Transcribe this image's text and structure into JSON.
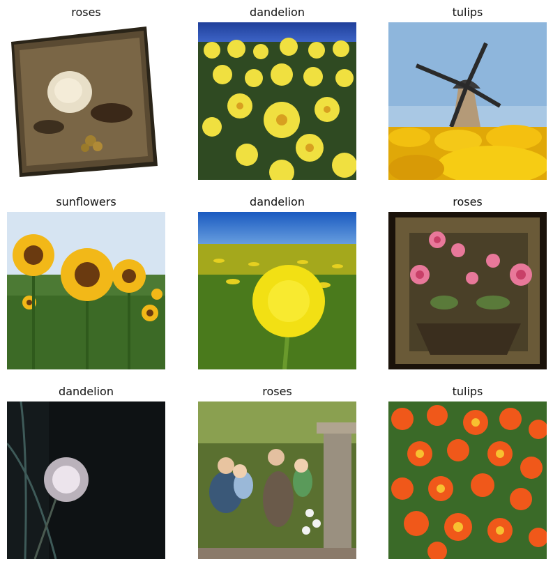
{
  "grid": {
    "items": [
      {
        "label": "roses"
      },
      {
        "label": "dandelion"
      },
      {
        "label": "tulips"
      },
      {
        "label": "sunflowers"
      },
      {
        "label": "dandelion"
      },
      {
        "label": "roses"
      },
      {
        "label": "dandelion"
      },
      {
        "label": "roses"
      },
      {
        "label": "tulips"
      }
    ]
  }
}
